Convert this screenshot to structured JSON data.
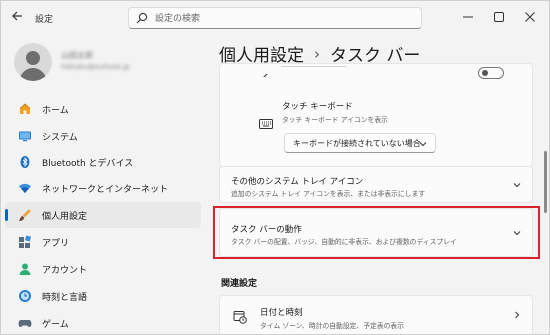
{
  "window": {
    "title": "設定"
  },
  "search": {
    "placeholder": "設定の検索"
  },
  "profile": {
    "name": "山田太郎",
    "email": "hikkaku@outlook.jp"
  },
  "sidebar": {
    "items": [
      {
        "label": "ホーム",
        "icon": "home-icon",
        "active": false
      },
      {
        "label": "システム",
        "icon": "system-icon",
        "active": false
      },
      {
        "label": "Bluetooth とデバイス",
        "icon": "bluetooth-icon",
        "active": false
      },
      {
        "label": "ネットワークとインターネット",
        "icon": "wifi-icon",
        "active": false
      },
      {
        "label": "個人用設定",
        "icon": "brush-icon",
        "active": true
      },
      {
        "label": "アプリ",
        "icon": "apps-icon",
        "active": false
      },
      {
        "label": "アカウント",
        "icon": "account-icon",
        "active": false
      },
      {
        "label": "時刻と言語",
        "icon": "time-language-icon",
        "active": false
      },
      {
        "label": "ゲーム",
        "icon": "game-icon",
        "active": false
      }
    ]
  },
  "breadcrumb": {
    "parent": "個人用設定",
    "current": "タスク バー"
  },
  "touch_keyboard": {
    "title": "タッチ キーボード",
    "desc": "タッチ キーボード アイコンを表示",
    "dropdown_value": "キーボードが接続されていない場合"
  },
  "other_tray": {
    "title": "その他のシステム トレイ アイコン",
    "desc": "追加のシステム トレイ アイコンを表示、または非表示にします"
  },
  "taskbar_behavior": {
    "title": "タスク バーの動作",
    "desc": "タスク バーの配置、バッジ、自動的に非表示、および複数のディスプレイ"
  },
  "related": {
    "heading": "関連設定",
    "date_time": {
      "title": "日付と時刻",
      "desc": "タイム ゾーン、時計の自動設定、予定表の表示"
    }
  },
  "colors": {
    "accent": "#0067c0",
    "highlight": "#d7232c"
  }
}
